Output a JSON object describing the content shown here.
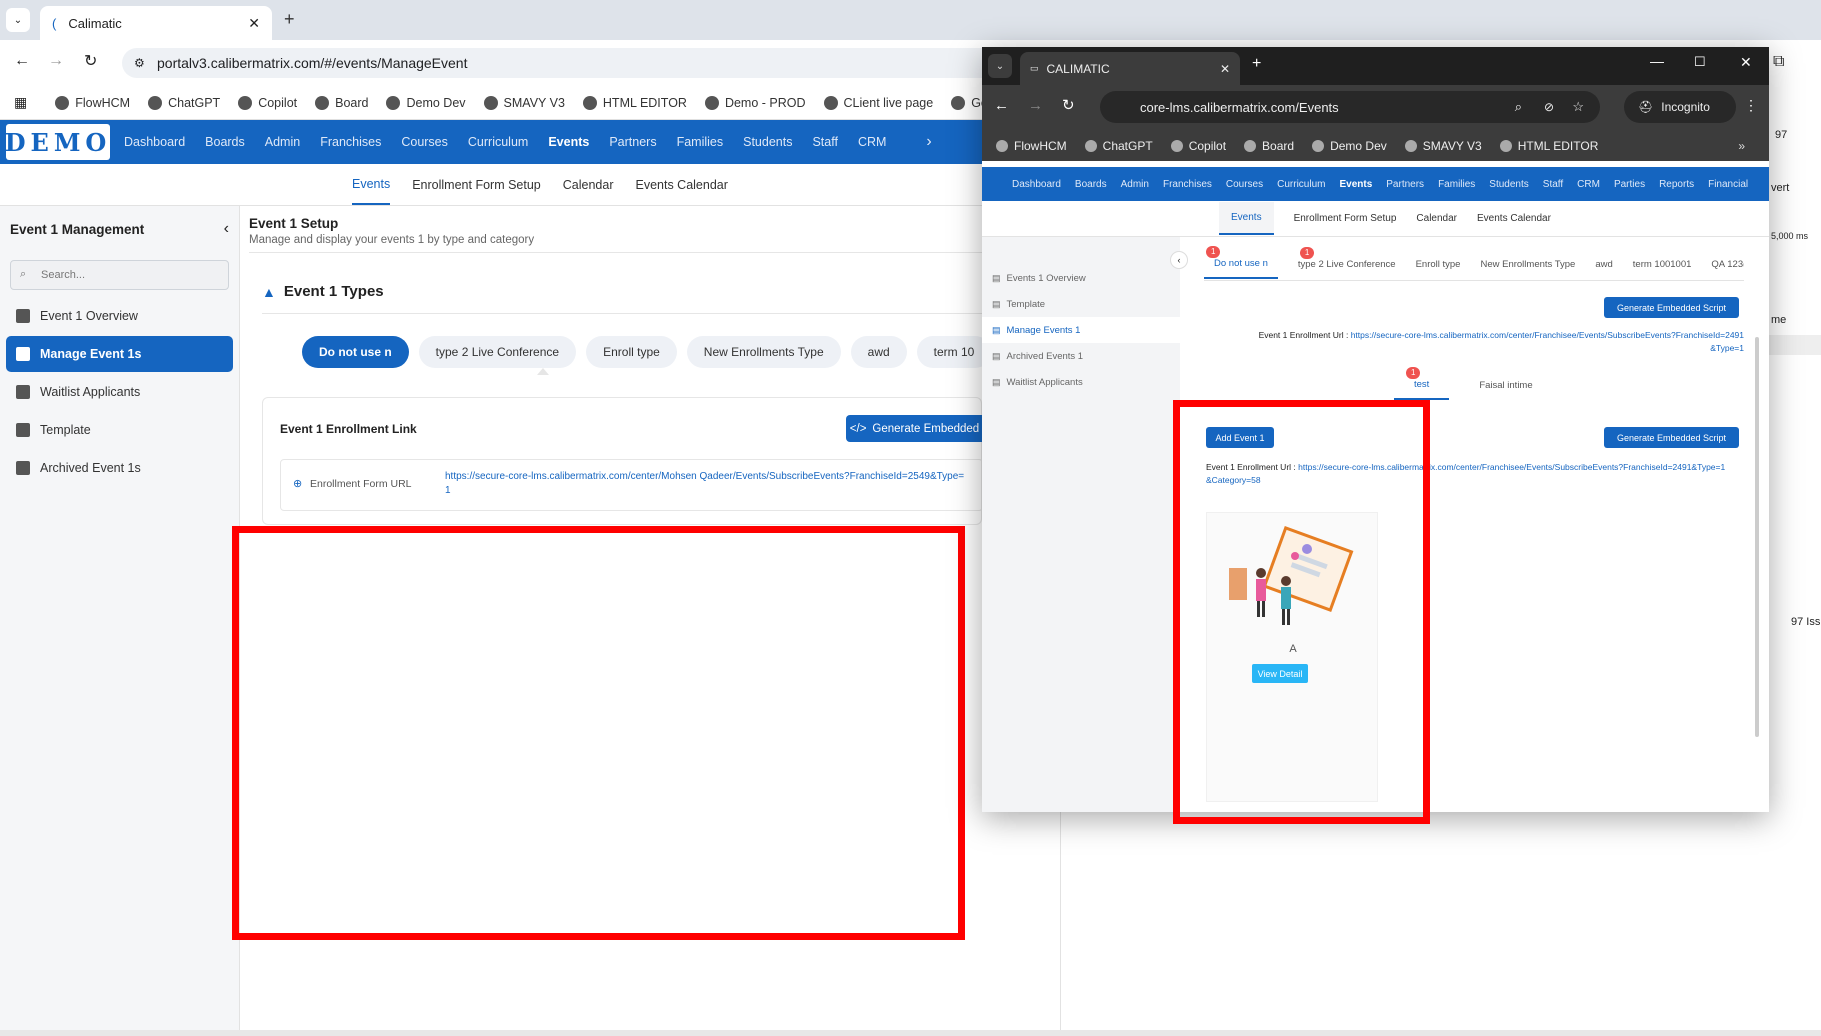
{
  "back_browser": {
    "tab_title": "Calimatic",
    "url": "portalv3.calibermatrix.com/#/events/ManageEvent",
    "bookmarks": [
      "FlowHCM",
      "ChatGPT",
      "Copilot",
      "Board",
      "Demo Dev",
      "SMAVY V3",
      "HTML EDITOR",
      "Demo - PROD",
      "CLient live page",
      "Google"
    ],
    "logo": "DEMO",
    "nav": [
      "Dashboard",
      "Boards",
      "Admin",
      "Franchises",
      "Courses",
      "Curriculum",
      "Events",
      "Partners",
      "Families",
      "Students",
      "Staff",
      "CRM"
    ],
    "active_nav": "Events",
    "subnav": [
      "Events",
      "Enrollment Form Setup",
      "Calendar",
      "Events Calendar"
    ],
    "sidebar": {
      "title": "Event 1 Management",
      "search_placeholder": "Search...",
      "items": [
        "Event 1 Overview",
        "Manage Event 1s",
        "Waitlist Applicants",
        "Template",
        "Archived Event 1s"
      ]
    },
    "main": {
      "title": "Event 1 Setup",
      "subtitle": "Manage and display your events 1 by type and category",
      "types_heading": "Event 1 Types",
      "types": [
        "Do not use n",
        "type 2 Live Conference",
        "Enroll type",
        "New Enrollments Type",
        "awd",
        "term 10"
      ],
      "link_heading": "Event 1 Enrollment Link",
      "generate_button": "Generate Embedded",
      "form_url_label": "Enrollment Form URL",
      "form_url": "https://secure-core-lms.calibermatrix.com/center/Mohsen Qadeer/Events/SubscribeEvents?FranchiseId=2549&Type=1"
    },
    "right_fragments": [
      "97",
      "5,000 ms",
      "vert",
      "me",
      "97 Iss"
    ]
  },
  "front_browser": {
    "tab_title": "CALIMATIC",
    "url": "core-lms.calibermatrix.com/Events",
    "incognito_label": "Incognito",
    "bookmarks": [
      "FlowHCM",
      "ChatGPT",
      "Copilot",
      "Board",
      "Demo Dev",
      "SMAVY V3",
      "HTML EDITOR"
    ],
    "nav": [
      "Dashboard",
      "Boards",
      "Admin",
      "Franchises",
      "Courses",
      "Curriculum",
      "Events",
      "Partners",
      "Families",
      "Students",
      "Staff",
      "CRM",
      "Parties",
      "Reports",
      "Financial"
    ],
    "subnav": [
      "Events",
      "Enrollment Form Setup",
      "Calendar",
      "Events Calendar"
    ],
    "sidebar": [
      "Events 1 Overview",
      "Template",
      "Manage Events 1",
      "Archived Events 1",
      "Waitlist Applicants"
    ],
    "type_tabs": [
      "Do not use n",
      "type 2 Live Conference",
      "Enroll type",
      "New Enrollments Type",
      "awd",
      "term 1001001",
      "QA 123("
    ],
    "badge_count": "1",
    "generate_button": "Generate Embedded Script",
    "enroll_url_label": "Event 1 Enrollment Url :",
    "enroll_url_top": "https://secure-core-lms.calibermatrix.com/center/Franchisee/Events/SubscribeEvents?FranchiseId=2491&Type=1",
    "category_tabs": [
      "test",
      "Faisal intime"
    ],
    "add_button": "Add Event 1",
    "enroll_url_cat": "https://secure-core-lms.calibermatrix.com/center/Franchisee/Events/SubscribeEvents?FranchiseId=2491&Type=1&Category=58",
    "card_title": "A",
    "view_button": "View Detail"
  }
}
